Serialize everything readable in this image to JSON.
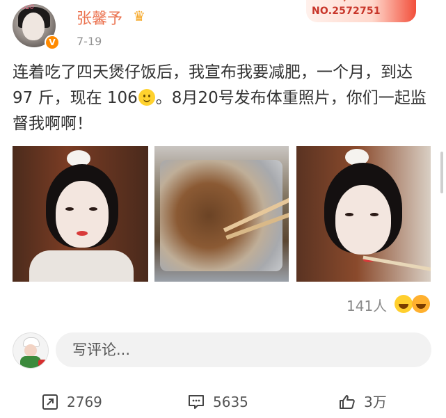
{
  "header": {
    "username": "张馨予",
    "date": "7-19",
    "avatar_ring_text": "2020",
    "badge_top_text": "V",
    "badge_number": "NO.2572751"
  },
  "post": {
    "text_part1": "连着吃了四天煲仔饭后，我宣布我要减肥，一个月，到达 97 斤，现在 106",
    "text_part2": "。8月20号发布体重照片，你们一起监督我啊啊！"
  },
  "reactions": {
    "count": "141人"
  },
  "comment": {
    "placeholder": "写评论..."
  },
  "actions": {
    "share_count": "2769",
    "comment_count": "5635",
    "like_count": "3万"
  },
  "colors": {
    "username": "#eb7350",
    "text": "#333333",
    "muted": "#939393",
    "verified": "#ff8a00",
    "input_bg": "#f2f2f2"
  },
  "icons": {
    "verified": "verified-v-icon",
    "crown": "crown-icon",
    "smile_emoji": "smile-emoji-icon",
    "share": "share-icon",
    "comment": "comment-icon",
    "like": "thumbs-up-icon"
  }
}
